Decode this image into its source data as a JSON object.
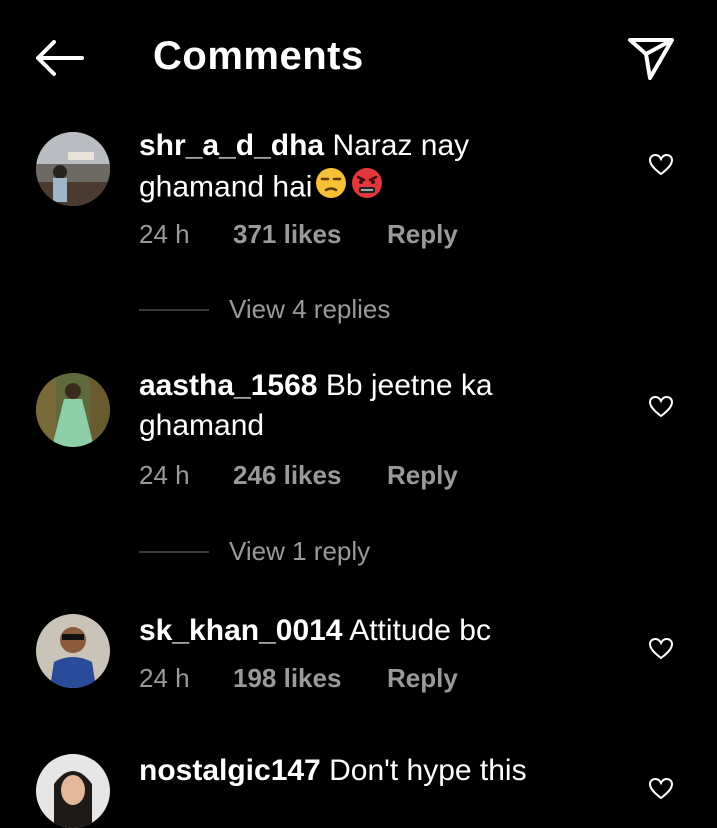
{
  "header": {
    "title": "Comments"
  },
  "comments": [
    {
      "username": "shr_a_d_dha",
      "text_line1": "Naraz nay",
      "text_line2": "ghamand hai",
      "emoji": [
        "unamused-face-emoji",
        "angry-face-with-symbols-emoji"
      ],
      "time": "24 h",
      "likes": "371 likes",
      "reply": "Reply",
      "view_replies": "View 4 replies"
    },
    {
      "username": "aastha_1568",
      "text_line1": "Bb jeetne ka",
      "text_line2": "ghamand",
      "time": "24 h",
      "likes": "246 likes",
      "reply": "Reply",
      "view_replies": "View 1 reply"
    },
    {
      "username": "sk_khan_0014",
      "text_line1": "Attitude bc",
      "time": "24 h",
      "likes": "198 likes",
      "reply": "Reply"
    },
    {
      "username": "nostalgic147",
      "text_line1": "Don't hype this"
    }
  ],
  "colors": {
    "background": "#000000",
    "text": "#ffffff",
    "muted": "#9a9a9a"
  }
}
